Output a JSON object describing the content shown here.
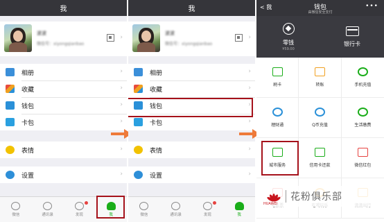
{
  "panel_me": {
    "title": "我",
    "profile_name": "波波",
    "profile_id": "微信号：xiyongqianbao",
    "menu": [
      {
        "label": "相册",
        "icon": "photo-icon",
        "color": "#3b8fd9"
      },
      {
        "label": "收藏",
        "icon": "favorites-cube-icon",
        "color": "#f0a020"
      },
      {
        "label": "钱包",
        "icon": "wallet-icon",
        "color": "#2a90d8"
      },
      {
        "label": "卡包",
        "icon": "card-pack-icon",
        "color": "#2aa0e0"
      },
      {
        "label": "表情",
        "icon": "smiley-icon",
        "color": "#f2c200"
      },
      {
        "label": "设置",
        "icon": "settings-gear-icon",
        "color": "#2e8fd8"
      }
    ],
    "tabs": [
      {
        "label": "微信",
        "icon": "chat-bubble-icon"
      },
      {
        "label": "通讯录",
        "icon": "contacts-icon"
      },
      {
        "label": "发现",
        "icon": "compass-icon"
      },
      {
        "label": "我",
        "icon": "person-icon"
      }
    ]
  },
  "panel_wallet": {
    "back": "< 我",
    "title": "钱包",
    "subtitle": "由微信安全支付",
    "more": "•••",
    "top": [
      {
        "label": "零钱",
        "sub": "¥59.00",
        "icon": "change-diamond-icon"
      },
      {
        "label": "银行卡",
        "sub": "",
        "icon": "bank-card-icon"
      }
    ],
    "grid": [
      {
        "label": "刷卡",
        "icon": "scan-card-icon",
        "color": "#1aad19"
      },
      {
        "label": "转账",
        "icon": "transfer-icon",
        "color": "#f0a020"
      },
      {
        "label": "手机充值",
        "icon": "phone-topup-icon",
        "color": "#1aad19"
      },
      {
        "label": "理财通",
        "icon": "wealth-icon",
        "color": "#2a90d8"
      },
      {
        "label": "Q币充值",
        "icon": "q-coin-icon",
        "color": "#2a90d8"
      },
      {
        "label": "生活缴费",
        "icon": "utility-payment-icon",
        "color": "#1aad19"
      },
      {
        "label": "城市服务",
        "icon": "city-service-icon",
        "color": "#1aad19"
      },
      {
        "label": "信用卡还款",
        "icon": "credit-card-icon",
        "color": "#1aad19"
      },
      {
        "label": "微信红包",
        "icon": "red-packet-icon",
        "color": "#e64340"
      },
      {
        "label": "电影票",
        "icon": "movie-ticket-icon",
        "color": "#e64340"
      },
      {
        "label": "吃喝玩乐",
        "icon": "food-icon",
        "color": "#f0a020"
      },
      {
        "label": "滴滴出行",
        "icon": "taxi-icon",
        "color": "#f0a020"
      }
    ]
  },
  "watermark": {
    "brand": "HUAWEI",
    "text": "花粉俱乐部"
  },
  "colors": {
    "titlebar": "#35353a",
    "highlight": "#a5111a",
    "arrow": "#ee7a3a",
    "active": "#1aad19"
  }
}
